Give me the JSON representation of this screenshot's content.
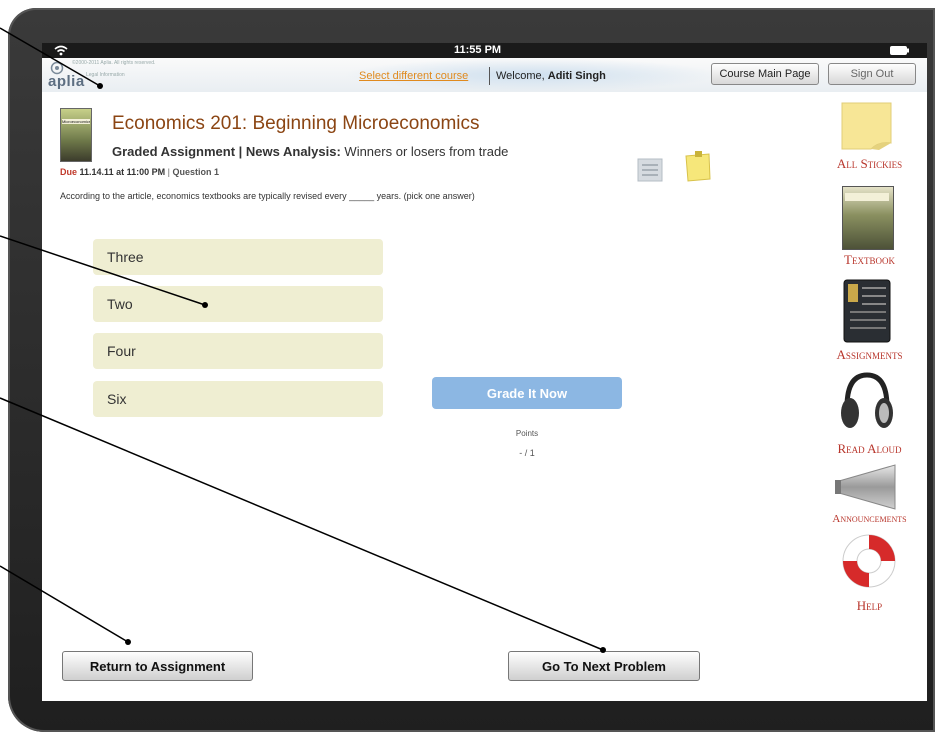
{
  "status_bar": {
    "time": "11:55 PM"
  },
  "header": {
    "logo_text": "aplia",
    "copyright_text": "©2000-2011 Aplia. All rights reserved.",
    "legal_text": "Legal Information",
    "select_course_link": "Select different course",
    "welcome_label": "Welcome,",
    "user_name": "Aditi Singh",
    "course_main_button": "Course Main Page",
    "sign_out_button": "Sign Out"
  },
  "course": {
    "cover_text": "Microeconomics",
    "title": "Economics 201: Beginning Microeconomics",
    "assignment_prefix": "Graded Assignment | News Analysis:",
    "assignment_name": "Winners or losers from trade",
    "due_label": "Due",
    "due_date": "11.14.11 at 11:00 PM",
    "question_label": "Question 1"
  },
  "question": {
    "prompt": "According to the article, economics textbooks are typically revised every _____ years. (pick one answer)",
    "choices": [
      "Three",
      "Two",
      "Four",
      "Six"
    ]
  },
  "grading": {
    "button": "Grade It Now",
    "points_label": "Points",
    "points_value": "- / 1"
  },
  "sidebar": {
    "items": [
      {
        "label": "All Stickies",
        "icon": "sticky-note-icon"
      },
      {
        "label": "Textbook",
        "icon": "textbook-icon"
      },
      {
        "label": "Assignments",
        "icon": "assignments-icon"
      },
      {
        "label": "Read Aloud",
        "icon": "headphones-icon"
      },
      {
        "label": "Announcements",
        "icon": "megaphone-icon"
      },
      {
        "label": "Help",
        "icon": "life-ring-icon"
      }
    ]
  },
  "footer": {
    "return_button": "Return to Assignment",
    "next_button": "Go To Next Problem"
  },
  "colors": {
    "course_title": "#8b4513",
    "sidebar_label": "#b8352b",
    "choice_bg": "#efeed2",
    "grade_button": "#8cb7e3",
    "due_date": "#c0392b"
  }
}
